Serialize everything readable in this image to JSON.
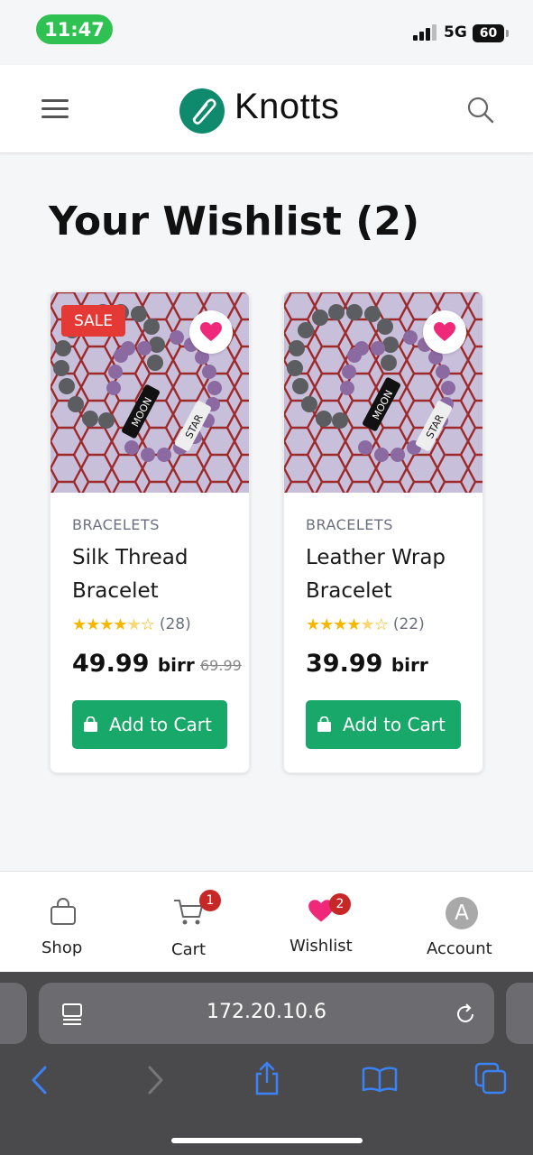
{
  "status_bar": {
    "time": "11:47",
    "network": "5G",
    "battery": "60"
  },
  "header": {
    "brand": "Knotts"
  },
  "page": {
    "title": "Your Wishlist (2)"
  },
  "products": [
    {
      "sale_badge": "SALE",
      "category": "BRACELETS",
      "name": "Silk Thread Bracelet",
      "rating": 4.5,
      "stars": "★★★★",
      "half_star": "★",
      "empty_star": "☆",
      "review_count": "(28)",
      "price": "49.99",
      "currency": "birr",
      "old_price": "69.99",
      "add_label": "Add to Cart",
      "image_text": [
        "MOON",
        "STAR"
      ]
    },
    {
      "category": "BRACELETS",
      "name": "Leather Wrap Bracelet",
      "rating": 4.5,
      "stars": "★★★★",
      "half_star": "★",
      "empty_star": "☆",
      "review_count": "(22)",
      "price": "39.99",
      "currency": "birr",
      "add_label": "Add to Cart",
      "image_text": [
        "MOON",
        "STAR"
      ]
    }
  ],
  "bottom_nav": {
    "shop": "Shop",
    "cart": "Cart",
    "cart_badge": "1",
    "wishlist": "Wishlist",
    "wishlist_badge": "2",
    "account": "Account",
    "account_initial": "A"
  },
  "browser": {
    "url": "172.20.10.6"
  },
  "colors": {
    "accent": "#18a869",
    "brand": "#0f8a6c",
    "sale": "#e53935",
    "heart": "#f0287a",
    "badge": "#c62828"
  }
}
